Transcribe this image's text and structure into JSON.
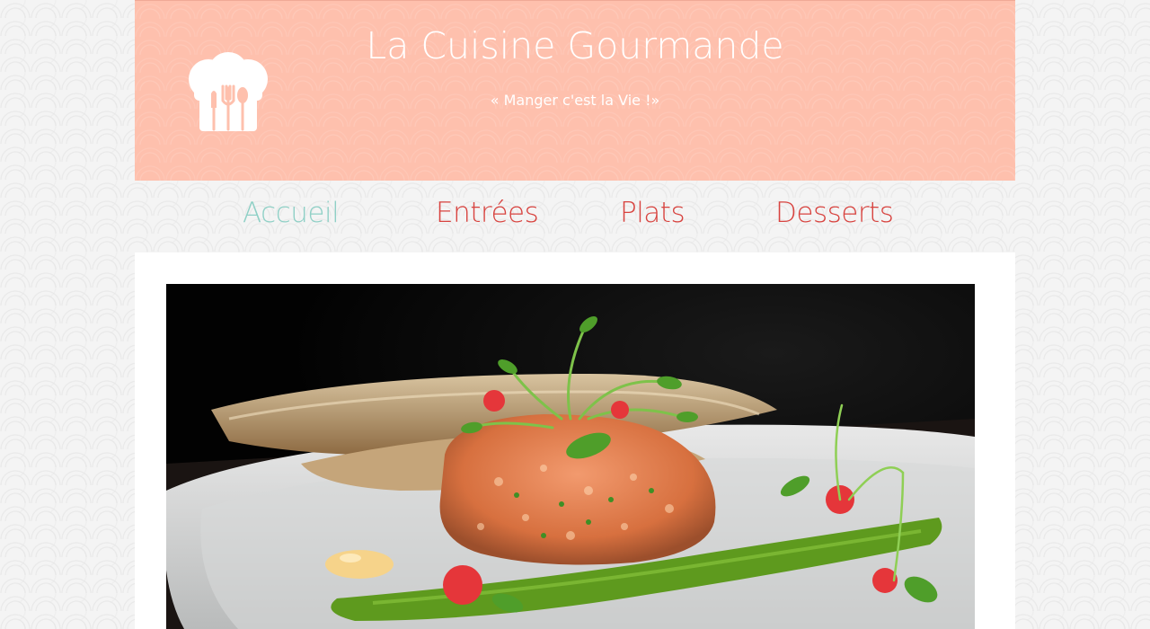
{
  "site": {
    "title": "La Cuisine Gourmande",
    "tagline": "« Manger c'est la Vie !»"
  },
  "nav": {
    "items": [
      {
        "label": "Accueil",
        "active": true
      },
      {
        "label": "Entrées",
        "active": false
      },
      {
        "label": "Plats",
        "active": false
      },
      {
        "label": "Desserts",
        "active": false
      }
    ]
  },
  "colors": {
    "header_bg": "#fec0ad",
    "nav_active": "#8fd0c6",
    "nav_item": "#d8433f"
  },
  "logo": {
    "icon": "chef-hat-utensils-icon"
  },
  "hero": {
    "subject": "salmon-tartare-plate-image"
  }
}
